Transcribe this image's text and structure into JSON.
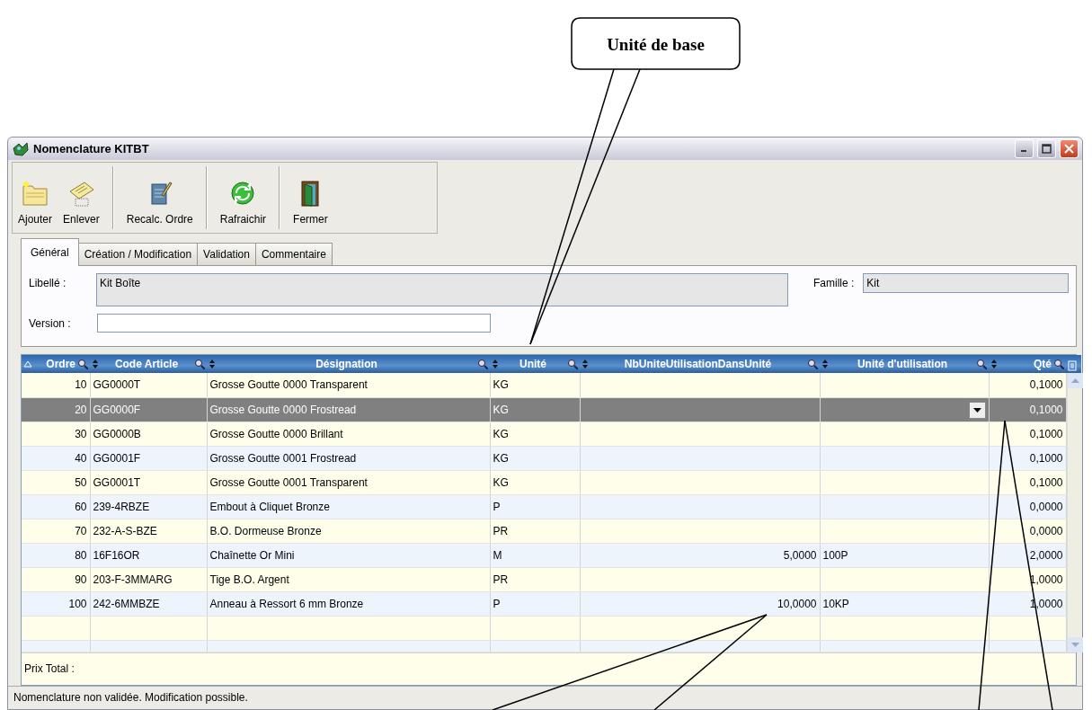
{
  "annotation": {
    "text": "Unité de base"
  },
  "window": {
    "title": "Nomenclature KITBT"
  },
  "toolbar": [
    {
      "label": "Ajouter",
      "kind": "folder"
    },
    {
      "label": "Enlever",
      "kind": "paper"
    },
    {
      "label": "Recalc. Ordre",
      "kind": "notepad"
    },
    {
      "label": "Rafraichir",
      "kind": "refresh"
    },
    {
      "label": "Fermer",
      "kind": "door"
    }
  ],
  "tabs": [
    {
      "label": "Général",
      "selected": true
    },
    {
      "label": "Création / Modification",
      "selected": false
    },
    {
      "label": "Validation",
      "selected": false
    },
    {
      "label": "Commentaire",
      "selected": false
    }
  ],
  "form": {
    "libelle": {
      "label": "Libellé :",
      "value": "Kit Boîte"
    },
    "famille": {
      "label": "Famille :",
      "value": "Kit"
    },
    "version": {
      "label": "Version :"
    }
  },
  "table": {
    "columns": [
      "Ordre",
      "Code Article",
      "Désignation",
      "Unité",
      "NbUniteUtilisationDansUnité",
      "Unité d'utilisation",
      "Qté"
    ],
    "rows": [
      {
        "cells": [
          "10",
          "GG0000T",
          "Grosse Goutte 0000 Transparent",
          "KG",
          "",
          "",
          "0,1000"
        ],
        "selected": false
      },
      {
        "cells": [
          "20",
          "GG0000F",
          "Grosse Goutte 0000 Frostread",
          "KG",
          "",
          "",
          "0,1000"
        ],
        "selected": true
      },
      {
        "cells": [
          "30",
          "GG0000B",
          "Grosse Goutte 0000 Brillant",
          "KG",
          "",
          "",
          "0,1000"
        ],
        "selected": false
      },
      {
        "cells": [
          "40",
          "GG0001F",
          "Grosse Goutte 0001 Frostread",
          "KG",
          "",
          "",
          "0,1000"
        ],
        "selected": false
      },
      {
        "cells": [
          "50",
          "GG0001T",
          "Grosse Goutte 0001 Transparent",
          "KG",
          "",
          "",
          "0,1000"
        ],
        "selected": false
      },
      {
        "cells": [
          "60",
          "239-4RBZE",
          "Embout à Cliquet Bronze",
          "P",
          "",
          "",
          "0,0000"
        ],
        "selected": false
      },
      {
        "cells": [
          "70",
          "232-A-S-BZE",
          "B.O. Dormeuse Bronze",
          "PR",
          "",
          "",
          "0,0000"
        ],
        "selected": false
      },
      {
        "cells": [
          "80",
          "16F16OR",
          "Chaînette Or Mini",
          "M",
          "5,0000",
          "100P",
          "2,0000"
        ],
        "selected": false
      },
      {
        "cells": [
          "90",
          "203-F-3MMARG",
          "Tige B.O. Argent",
          "PR",
          "",
          "",
          "1,0000"
        ],
        "selected": false
      },
      {
        "cells": [
          "100",
          "242-6MMBZE",
          "Anneau à Ressort 6 mm Bronze",
          "P",
          "10,0000",
          "10KP",
          "1,0000"
        ],
        "selected": false
      }
    ],
    "footer": "Prix Total :"
  },
  "status_bar": "Nomenclature non validée. Modification possible."
}
